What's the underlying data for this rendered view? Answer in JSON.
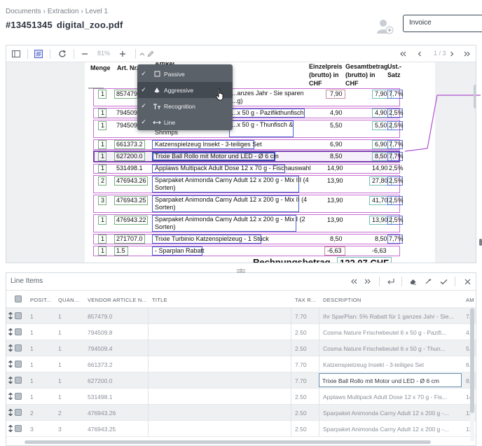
{
  "breadcrumb": [
    "Documents",
    "Extraction",
    "Level 1"
  ],
  "breadcrumb_sep": "›",
  "document": {
    "id": "#13451345",
    "filename": "digital_zoo.pdf"
  },
  "doctype_field": {
    "value": "Invoice"
  },
  "viewer": {
    "zoom": "81%",
    "page": "1 / 3"
  },
  "dropdown": {
    "items": [
      {
        "label": "Passive",
        "checked": true,
        "icon": "square-outline-icon"
      },
      {
        "label": "Aggressive",
        "checked": true,
        "icon": "fill-bucket-icon",
        "active": true
      },
      {
        "label": "Recognition",
        "checked": true,
        "icon": "text-recognition-icon"
      },
      {
        "label": "Line",
        "checked": true,
        "icon": "horizontal-arrows-icon"
      }
    ]
  },
  "pdf": {
    "headers": {
      "menge": "Menge",
      "artnr": "Art. Nr.",
      "artikel": "Artikel",
      "einzelpreis": [
        "Einzelpreis",
        "(brutto) in",
        "CHF"
      ],
      "gesamtbetrag": [
        "Gesamtbetrag",
        "(brutto) in",
        "CHF"
      ],
      "ust": [
        "Ust.-",
        "Satz"
      ]
    },
    "rows": [
      {
        "qty": "1",
        "art": "857479.0",
        "desc": "...anzes Jahr - Sie sparen",
        "desc2": "...g)",
        "price": "7,90",
        "total": "7,90",
        "tax": "7,7%"
      },
      {
        "qty": "1",
        "art": "794509.8",
        "desc": "...x 50 g - Pazifikthunfisch",
        "desc2": "",
        "price": "4,90",
        "total": "4,90",
        "tax": "2,5%"
      },
      {
        "qty": "1",
        "art": "794509.4",
        "desc": "...x 50 g - Thunfisch &",
        "desc2": "Shrimps",
        "price": "5,50",
        "total": "5,50",
        "tax": "2,5%"
      },
      {
        "qty": "1",
        "art": "661373.2",
        "desc": "Katzenspielzeug Insekt - 3-teiliges Set",
        "desc2": "",
        "price": "6,90",
        "total": "6,90",
        "tax": "7,7%"
      },
      {
        "qty": "1",
        "art": "627200.0",
        "desc": "Trixie Ball Rollo mit Motor und LED - Ø 6 cm",
        "desc2": "",
        "price": "8,50",
        "total": "8,50",
        "tax": "7,7%"
      },
      {
        "qty": "1",
        "art": "531498.1",
        "desc": "Applaws Multipack Adult Dose 12 x 70 g - Fischauswahl",
        "desc2": "",
        "price": "14,90",
        "total": "14,90",
        "tax": "2,5%"
      },
      {
        "qty": "2",
        "art": "476943.26",
        "desc": "Sparpaket Animonda Carny Adult 12 x 200 g - Mix III (4",
        "desc2": "Sorten)",
        "price": "13,90",
        "total": "27,80",
        "tax": "2,5%"
      },
      {
        "qty": "3",
        "art": "476943.25",
        "desc": "Sparpaket Animonda Carny Adult 12 x 200 g - Mix II (4",
        "desc2": "Sorten)",
        "price": "13,90",
        "total": "41,70",
        "tax": "2,5%"
      },
      {
        "qty": "1",
        "art": "476943.22",
        "desc": "Sparpaket Animonda Carny Adult 12 x 200 g - Mix I (2",
        "desc2": "Sorten)",
        "price": "13,90",
        "total": "13,90",
        "tax": "2,5%"
      },
      {
        "qty": "1",
        "art": "271707.0",
        "desc": "Trixie Turbinio Katzenspielzeug - 1 Stück",
        "desc2": "",
        "price": "8,50",
        "total": "8,50",
        "tax": "7,7%"
      },
      {
        "qty": "1",
        "art": "1.5",
        "desc": "- Sparplan Rabatt",
        "desc2": "",
        "price": "-6,63",
        "total": "-6,63",
        "tax": ""
      }
    ],
    "total_label": "Rechnungsbetrag",
    "total_value": "122,07 CHF"
  },
  "line_items": {
    "title": "Line Items",
    "columns": [
      "POSIT...",
      "QUAN...",
      "VENDOR ARTICLE N...",
      "TITLE",
      "TAX R...",
      "DESCRIPTION",
      "AM"
    ],
    "rows": [
      {
        "pos": "1",
        "qty": "1",
        "art": "857479.0",
        "title": "",
        "tax": "7.70",
        "desc": "Ihr SparPlan: 5% Rabatt für 1 ganzes Jahr - Sie...",
        "am": "7.9"
      },
      {
        "pos": "1",
        "qty": "1",
        "art": "794509.8",
        "title": "",
        "tax": "2.50",
        "desc": "Cosma Nature Frischebeutel 6 x 50 g - Pazifi...",
        "am": "4.9"
      },
      {
        "pos": "1",
        "qty": "1",
        "art": "794509.4",
        "title": "",
        "tax": "2.50",
        "desc": "Cosma Nature Frischebeutel 6 x 50 g - Thun...",
        "am": "5.5"
      },
      {
        "pos": "1",
        "qty": "1",
        "art": "661373.2",
        "title": "",
        "tax": "7.70",
        "desc": "Katzenspielzeug Insekt - 3-teiliges Set",
        "am": "6.9"
      },
      {
        "pos": "1",
        "qty": "1",
        "art": "627200.0",
        "title": "",
        "tax": "7.70",
        "desc": "Trixie Ball Rollo mit Motor und LED - Ø 6 cm",
        "am": "8.5",
        "selected": true
      },
      {
        "pos": "1",
        "qty": "1",
        "art": "531498.1",
        "title": "",
        "tax": "2.50",
        "desc": "Applaws Multipack Adult Dose 12 x 70 g - Fis...",
        "am": "14"
      },
      {
        "pos": "2",
        "qty": "2",
        "art": "476943.26",
        "title": "",
        "tax": "2.50",
        "desc": "Sparpaket Animonda Carny Adult 12 x 200 g -...",
        "am": "13"
      },
      {
        "pos": "3",
        "qty": "3",
        "art": "476943.25",
        "title": "",
        "tax": "2.50",
        "desc": "Sparpaket Animonda Carny Adult 12 x 200 g -...",
        "am": "13"
      }
    ]
  },
  "colors": {
    "accent": "#7e3fb0",
    "row_box": "#c76fd2",
    "connector": "#b04fd0",
    "dropdown_bg": "#5b6168"
  }
}
